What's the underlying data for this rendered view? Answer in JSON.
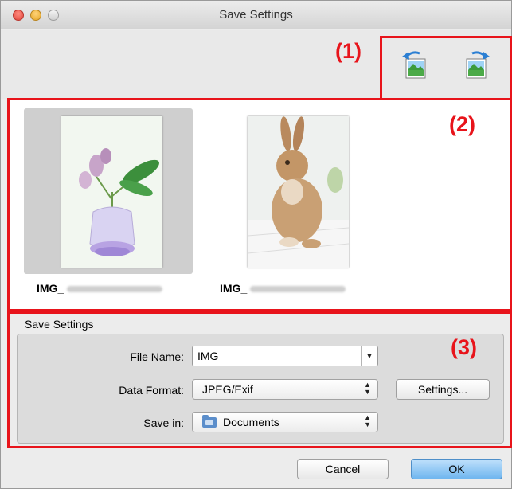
{
  "window": {
    "title": "Save Settings"
  },
  "callouts": {
    "c1": "(1)",
    "c2": "(2)",
    "c3": "(3)"
  },
  "toolbar": {
    "icons": [
      "rotate-left-icon",
      "rotate-right-icon"
    ]
  },
  "thumbnails": [
    {
      "label": "IMG_",
      "selected": true
    },
    {
      "label": "IMG_",
      "selected": false
    }
  ],
  "save_settings": {
    "heading": "Save Settings",
    "file_name_label": "File Name:",
    "file_name_value": "IMG",
    "data_format_label": "Data Format:",
    "data_format_value": "JPEG/Exif",
    "settings_button": "Settings...",
    "save_in_label": "Save in:",
    "save_in_value": "Documents"
  },
  "buttons": {
    "cancel": "Cancel",
    "ok": "OK"
  },
  "colors": {
    "callout": "#e8141b",
    "ok_button": "#6fb6ef",
    "selection": "#cfcfcf"
  }
}
